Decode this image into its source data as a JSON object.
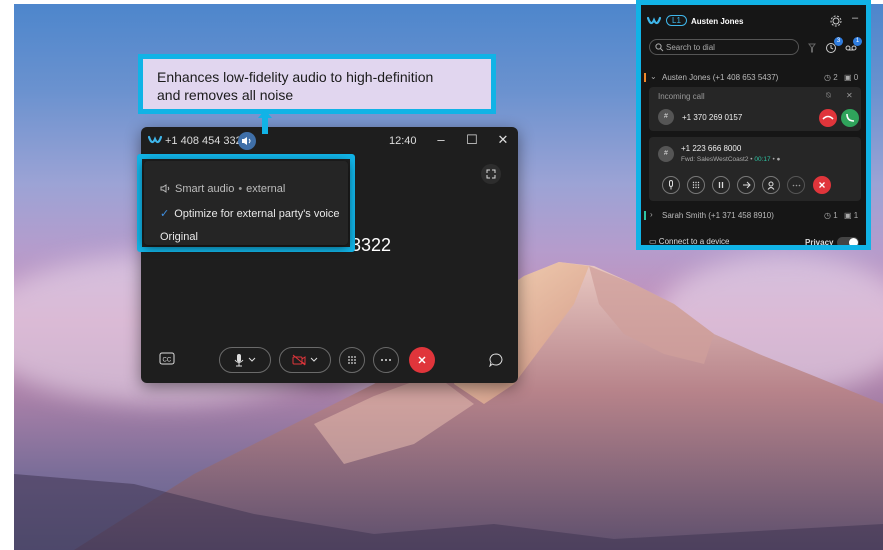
{
  "callout": {
    "line1": "Enhances low-fidelity audio to high-definition",
    "line2": "and removes all noise"
  },
  "call_window": {
    "number": "+1 408 454 3322",
    "time": "12:40",
    "big_number_partial": "3322",
    "controls": [
      "closed-captions-icon",
      "microphone-icon",
      "video-off-icon",
      "keypad-icon",
      "more-icon",
      "end-call-icon",
      "chat-icon"
    ]
  },
  "smart_audio_menu": {
    "header_label": "Smart audio",
    "header_value": "external",
    "dot": "•",
    "option_selected": "Optimize for external party's voice",
    "option_other": "Original",
    "check": "✓"
  },
  "dialer": {
    "user_badge": "L1",
    "user_name": "Austen Jones",
    "search_placeholder": "Search to dial",
    "badge_history": "3",
    "badge_voicemail": "1",
    "line1_label": "Austen Jones (+1 408 653 5437)",
    "line1_calls": "2",
    "line1_vm": "0",
    "incoming_label": "Incoming call",
    "incoming_number": "+1 370 269 0157",
    "active_number": "+1 223 666 8000",
    "active_fwd": "Fwd: SalesWestCoast2",
    "active_timer": "00:17",
    "dot": "•",
    "line2_label": "Sarah Smith (+1 371 458 8910)",
    "line2_calls": "1",
    "line2_vm": "1",
    "connect_label": "Connect to a device",
    "privacy_label": "Privacy",
    "colors": {
      "accent": "#11b3e6",
      "decline": "#e0353b",
      "answer": "#2fa35b",
      "line1": "#f0882a",
      "line2": "#2ec4a3"
    }
  }
}
